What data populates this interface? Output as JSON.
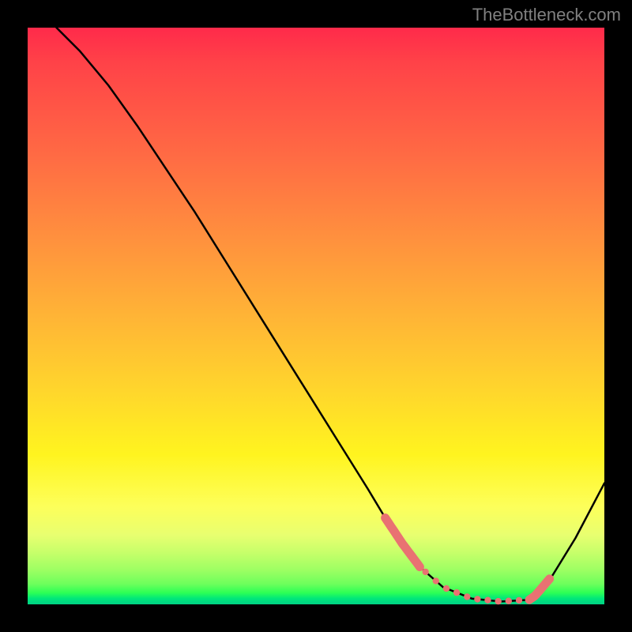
{
  "watermark": "TheBottleneck.com",
  "chart_data": {
    "type": "line",
    "title": "",
    "xlabel": "",
    "ylabel": "",
    "xlim": [
      0,
      1
    ],
    "ylim": [
      0,
      1
    ],
    "series": [
      {
        "name": "curve",
        "x": [
          0.05,
          0.09,
          0.14,
          0.19,
          0.24,
          0.29,
          0.34,
          0.39,
          0.44,
          0.49,
          0.54,
          0.59,
          0.62,
          0.65,
          0.68,
          0.72,
          0.77,
          0.82,
          0.87,
          0.88,
          0.91,
          0.95,
          1.0
        ],
        "y": [
          1.0,
          0.96,
          0.9,
          0.83,
          0.755,
          0.68,
          0.6,
          0.52,
          0.44,
          0.36,
          0.28,
          0.2,
          0.15,
          0.105,
          0.065,
          0.03,
          0.01,
          0.005,
          0.008,
          0.015,
          0.05,
          0.115,
          0.21
        ]
      }
    ],
    "marker_ranges": {
      "left": {
        "x0": 0.62,
        "x1": 0.68
      },
      "right": {
        "x0": 0.87,
        "x1": 0.905
      },
      "bottom": {
        "x0": 0.69,
        "x1": 0.87
      }
    },
    "colors": {
      "curve": "#000000",
      "markers": "#e97272"
    }
  }
}
